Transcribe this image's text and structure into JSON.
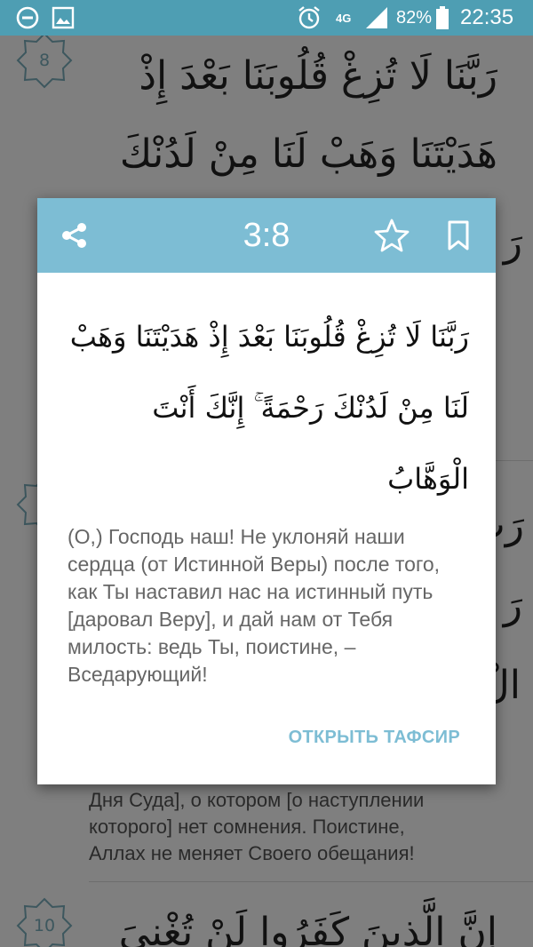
{
  "status_bar": {
    "network": "4G",
    "battery_percent": "82%",
    "time": "22:35",
    "icons": [
      "do-not-disturb-icon",
      "image-notification-icon",
      "alarm-icon",
      "signal-icon",
      "battery-icon"
    ]
  },
  "background": {
    "ayah_numbers": [
      "8",
      "10"
    ],
    "arabic_line_1": "رَبَّنَا لَا تُزِغْ قُلُوبَنَا بَعْدَ إِذْ",
    "arabic_line_2": "هَدَيْتَنَا وَهَبْ لَنَا مِنْ لَدُنْكَ",
    "arabic_fragment_r1": "رَ",
    "arabic_fragment_r2": "رَبَّ",
    "arabic_fragment_r3": "رَ",
    "arabic_fragment_r4": "الْ",
    "translation_lines": [
      "Дня Суда], о котором [о наступлении",
      "которого] нет сомнения. Поистине,",
      "Аллах не меняет Своего обещания!"
    ],
    "arabic_bottom": "إِنَّ الَّذِينَ كَفَرُوا لَنْ تُغْنِيَ"
  },
  "dialog": {
    "title": "3:8",
    "arabic_text": "رَبَّنَا لَا تُزِغْ قُلُوبَنَا بَعْدَ إِذْ هَدَيْتَنَا وَهَبْ لَنَا مِنْ لَدُنْكَ رَحْمَةً ۚ إِنَّكَ أَنْتَ الْوَهَّابُ",
    "translation": "(О,) Господь наш! Не уклоняй наши сердца (от Истинной Веры) после того, как Ты наставил нас на истинный путь [даровал Веру], и дай нам от Тебя милость: ведь Ты, поистине, – Вседарующий!",
    "action_label": "ОТКРЫТЬ ТАФСИР",
    "icons": [
      "share-icon",
      "star-icon",
      "bookmark-icon"
    ]
  },
  "colors": {
    "status_bar": "#4e9eb3",
    "dialog_header": "#7dbdd4",
    "accent": "#7dbdd4"
  }
}
